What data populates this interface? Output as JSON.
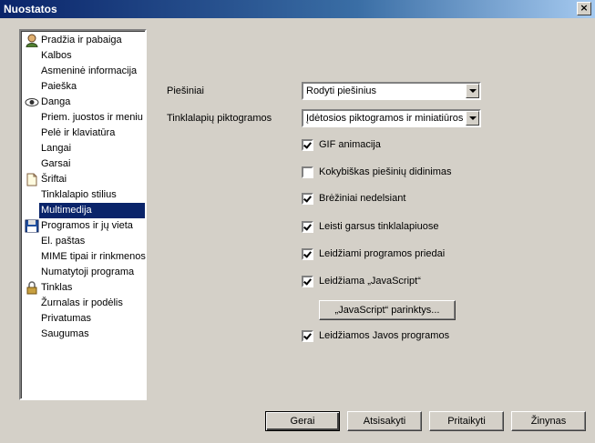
{
  "window": {
    "title": "Nuostatos"
  },
  "sidebar": {
    "items": [
      {
        "label": "Pradžia ir pabaiga",
        "icon": "user-icon"
      },
      {
        "label": "Kalbos"
      },
      {
        "label": "Asmeninė informacija"
      },
      {
        "label": "Paieška"
      },
      {
        "label": "Danga",
        "icon": "eye-icon"
      },
      {
        "label": "Priem. juostos ir meniu"
      },
      {
        "label": "Pelė ir klaviatūra"
      },
      {
        "label": "Langai"
      },
      {
        "label": "Garsai"
      },
      {
        "label": "Šriftai",
        "icon": "document-icon"
      },
      {
        "label": "Tinklalapio stilius"
      },
      {
        "label": "Multimedija",
        "selected": true
      },
      {
        "label": "Programos ir jų vieta",
        "icon": "floppy-icon"
      },
      {
        "label": "El. paštas"
      },
      {
        "label": "MIME tipai ir rinkmenos"
      },
      {
        "label": "Numatytoji programa"
      },
      {
        "label": "Tinklas",
        "icon": "lock-icon"
      },
      {
        "label": "Žurnalas ir podėlis"
      },
      {
        "label": "Privatumas"
      },
      {
        "label": "Saugumas"
      }
    ]
  },
  "main": {
    "images_label": "Piešiniai",
    "images_value": "Rodyti piešinius",
    "icons_label": "Tinklalapių piktogramos",
    "icons_value": "Įdėtosios piktogramos ir miniatiūros",
    "checkboxes": [
      {
        "label": "GIF animacija",
        "checked": true
      },
      {
        "label": "Kokybiškas piešinių didinimas",
        "checked": false
      },
      {
        "label": "Brėžiniai nedelsiant",
        "checked": true
      },
      {
        "label": "Leisti garsus tinklalapiuose",
        "checked": true
      },
      {
        "label": "Leidžiami programos priedai",
        "checked": true
      },
      {
        "label": "Leidžiama „JavaScript“",
        "checked": true
      },
      {
        "label": "Leidžiamos Javos programos",
        "checked": true
      }
    ],
    "js_options_button": "„JavaScript“ parinktys..."
  },
  "footer": {
    "ok": "Gerai",
    "cancel": "Atsisakyti",
    "apply": "Pritaikyti",
    "help": "Žinynas"
  }
}
